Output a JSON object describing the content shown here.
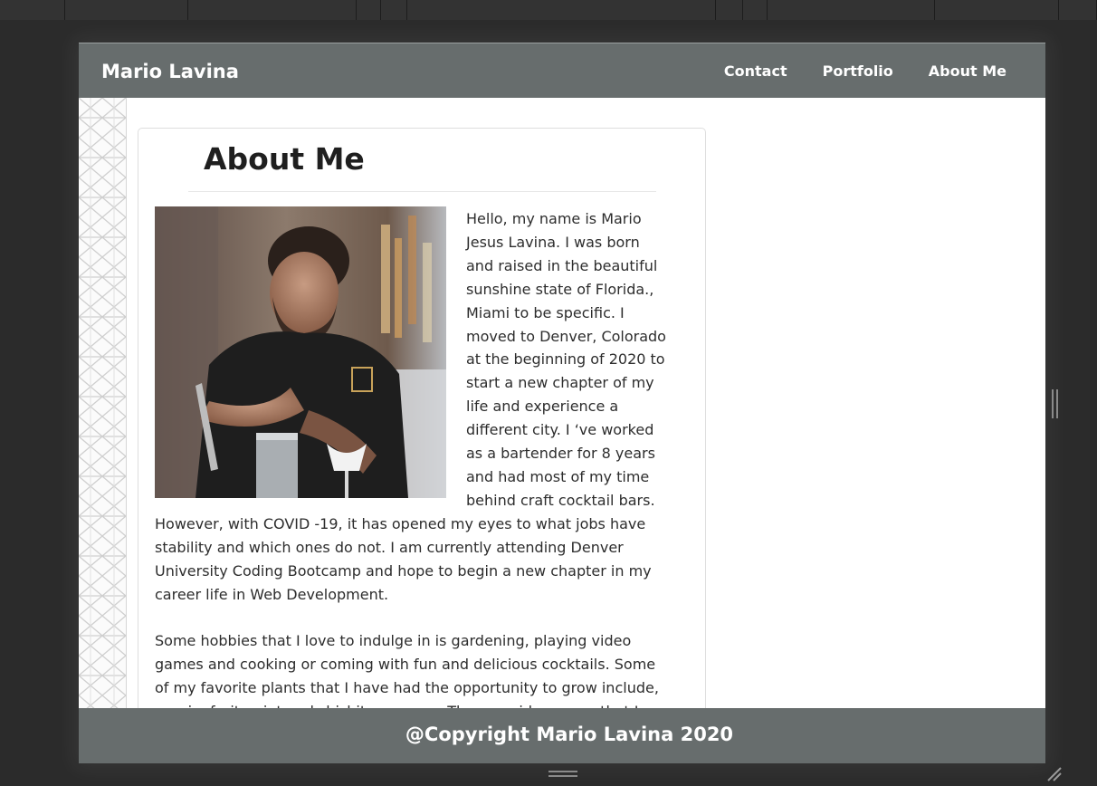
{
  "site": {
    "brand": "Mario Lavina",
    "nav": [
      {
        "label": "Contact"
      },
      {
        "label": "Portfolio"
      },
      {
        "label": "About Me"
      }
    ]
  },
  "about": {
    "title": "About Me",
    "paragraphs": [
      "Hello, my name is Mario Jesus Lavina. I was born and raised in the beautiful sunshine state of Florida., Miami to be specific. I moved to Denver, Colorado at the beginning of 2020 to start a new chapter of my life and experience a different city. I ‘ve worked as a bartender for 8 years and had most of my time behind craft cocktail bars. However, with COVID -19, it has opened my eyes to what jobs have stability and which ones do not. I am currently attending Denver University Coding Bootcamp and hope to begin a new chapter in my career life in Web Development.",
      "Some hobbies that I love to indulge in is gardening, playing video games and cooking or coming with fun and delicious cocktails. Some of my favorite plants that I have had the opportunity to grow include, passionfruit, mint and shishito peppers. The one video game that I love and put a lot of hours into is called Ghost of Tsushima. And my favorite"
    ]
  },
  "footer": {
    "text": "@Copyright Mario Lavina 2020"
  },
  "colors": {
    "header_bg": "#676d6d",
    "footer_bg": "#676d6d",
    "chrome_bg": "#2b2b2b"
  },
  "icons": {
    "resize_grip": "resize-grip-icon",
    "vertical_handle": "vertical-drag-handle-icon",
    "horizontal_handle": "horizontal-drag-handle-icon"
  }
}
